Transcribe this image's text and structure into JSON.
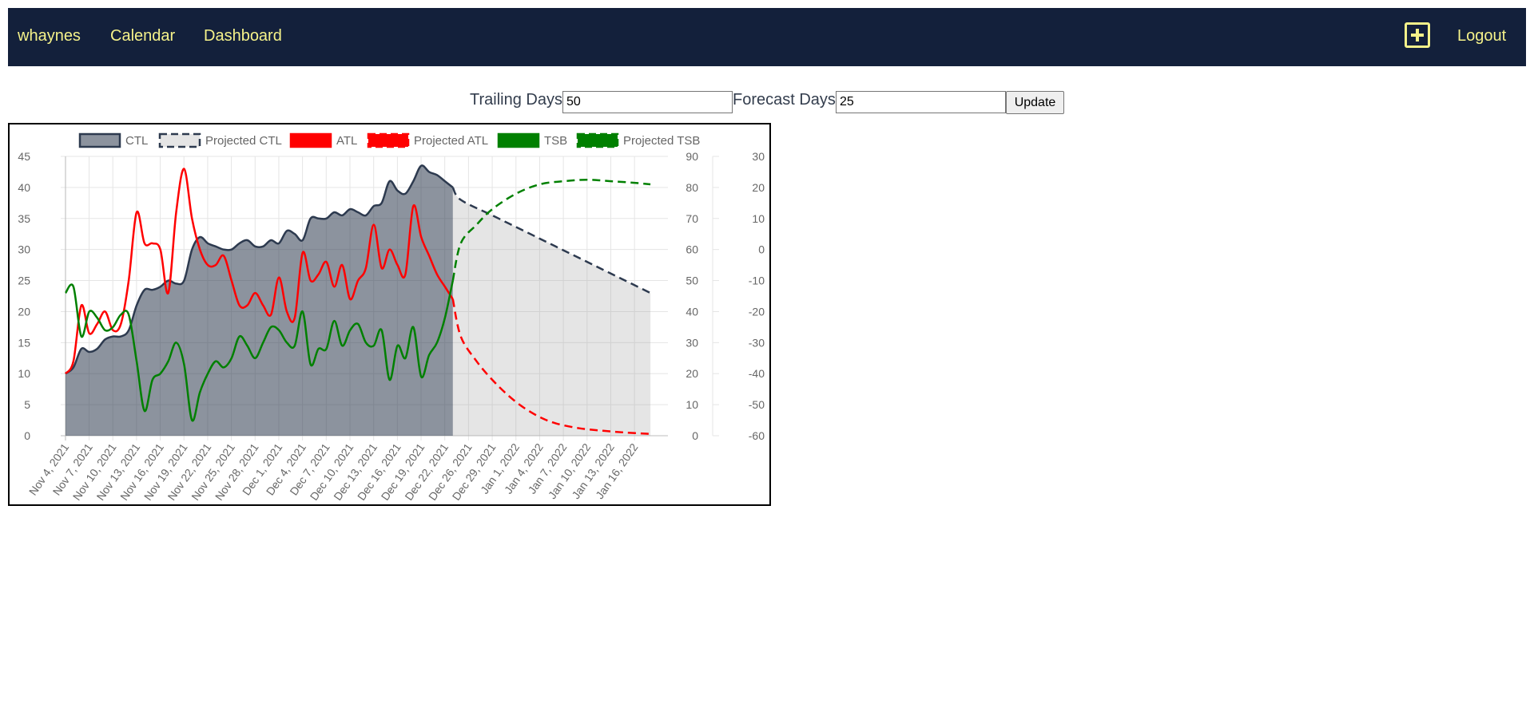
{
  "nav": {
    "user": "whaynes",
    "calendar": "Calendar",
    "dashboard": "Dashboard",
    "add_icon": "plus-square-icon",
    "logout": "Logout"
  },
  "controls": {
    "trailing_label": "Trailing Days",
    "trailing_value": "50",
    "forecast_label": "Forecast Days",
    "forecast_value": "25",
    "update_label": "Update"
  },
  "colors": {
    "nav_bg": "#13203b",
    "nav_text": "#f5f28a",
    "ctl": "#2d3a4f",
    "atl": "#ff0000",
    "tsb": "#008000"
  },
  "chart_data": {
    "type": "line",
    "x_tick_labels": [
      "Nov 4, 2021",
      "Nov 7, 2021",
      "Nov 10, 2021",
      "Nov 13, 2021",
      "Nov 16, 2021",
      "Nov 19, 2021",
      "Nov 22, 2021",
      "Nov 25, 2021",
      "Nov 28, 2021",
      "Dec 1, 2021",
      "Dec 4, 2021",
      "Dec 7, 2021",
      "Dec 10, 2021",
      "Dec 13, 2021",
      "Dec 16, 2021",
      "Dec 19, 2021",
      "Dec 22, 2021",
      "Dec 26, 2021",
      "Dec 29, 2021",
      "Jan 1, 2022",
      "Jan 4, 2022",
      "Jan 7, 2022",
      "Jan 10, 2022",
      "Jan 13, 2022",
      "Jan 16, 2022"
    ],
    "x_range": [
      "2021-11-04",
      "2022-01-18"
    ],
    "y_axes": {
      "left": {
        "min": 0,
        "max": 45,
        "ticks": [
          "45",
          "40",
          "35",
          "30",
          "25",
          "20",
          "15",
          "10",
          "5",
          "0"
        ]
      },
      "right1": {
        "min": 0,
        "max": 90,
        "ticks": [
          "90",
          "80",
          "70",
          "60",
          "50",
          "40",
          "30",
          "20",
          "10",
          "0"
        ]
      },
      "right2": {
        "min": -60,
        "max": 30,
        "ticks": [
          "30",
          "20",
          "10",
          "0",
          "-10",
          "-20",
          "-30",
          "-40",
          "-50",
          "-60"
        ]
      }
    },
    "legend": {
      "position": "top",
      "items": [
        "CTL",
        "Projected CTL",
        "ATL",
        "Projected ATL",
        "TSB",
        "Projected TSB"
      ]
    },
    "grid": true,
    "series": [
      {
        "name": "CTL",
        "axis": "left",
        "fill": true,
        "dashed": false,
        "x": [
          "2021-11-04",
          "2021-11-05",
          "2021-11-06",
          "2021-11-07",
          "2021-11-08",
          "2021-11-09",
          "2021-11-10",
          "2021-11-11",
          "2021-11-12",
          "2021-11-13",
          "2021-11-14",
          "2021-11-15",
          "2021-11-16",
          "2021-11-17",
          "2021-11-18",
          "2021-11-19",
          "2021-11-20",
          "2021-11-21",
          "2021-11-22",
          "2021-11-23",
          "2021-11-24",
          "2021-11-25",
          "2021-11-26",
          "2021-11-27",
          "2021-11-28",
          "2021-11-29",
          "2021-11-30",
          "2021-12-01",
          "2021-12-02",
          "2021-12-03",
          "2021-12-04",
          "2021-12-05",
          "2021-12-06",
          "2021-12-07",
          "2021-12-08",
          "2021-12-09",
          "2021-12-10",
          "2021-12-11",
          "2021-12-12",
          "2021-12-13",
          "2021-12-14",
          "2021-12-15",
          "2021-12-16",
          "2021-12-17",
          "2021-12-18",
          "2021-12-19",
          "2021-12-20",
          "2021-12-21",
          "2021-12-22",
          "2021-12-23"
        ],
        "values": [
          10,
          11,
          14,
          13.5,
          14,
          15.5,
          16,
          16,
          17,
          21,
          23.5,
          23.5,
          24,
          25,
          24.5,
          25,
          30,
          32,
          31,
          30.5,
          30,
          30,
          31,
          31.5,
          30.5,
          30.5,
          31.5,
          31,
          33,
          32.5,
          31.5,
          35,
          35,
          35,
          36,
          35.5,
          36.5,
          36,
          35.5,
          37,
          37.5,
          41,
          39.5,
          39,
          41,
          43.5,
          42.5,
          42,
          41,
          40
        ]
      },
      {
        "name": "Projected CTL",
        "axis": "left",
        "fill": true,
        "dashed": true,
        "x": [
          "2021-12-23",
          "2021-12-24",
          "2021-12-28",
          "2022-01-01",
          "2022-01-05",
          "2022-01-09",
          "2022-01-13",
          "2022-01-17"
        ],
        "values": [
          40,
          38,
          35.5,
          33,
          30.5,
          28,
          25.5,
          23
        ]
      },
      {
        "name": "ATL",
        "axis": "left",
        "fill": false,
        "dashed": false,
        "x": [
          "2021-11-04",
          "2021-11-05",
          "2021-11-06",
          "2021-11-07",
          "2021-11-08",
          "2021-11-09",
          "2021-11-10",
          "2021-11-11",
          "2021-11-12",
          "2021-11-13",
          "2021-11-14",
          "2021-11-15",
          "2021-11-16",
          "2021-11-17",
          "2021-11-18",
          "2021-11-19",
          "2021-11-20",
          "2021-11-21",
          "2021-11-22",
          "2021-11-23",
          "2021-11-24",
          "2021-11-25",
          "2021-11-26",
          "2021-11-27",
          "2021-11-28",
          "2021-11-29",
          "2021-11-30",
          "2021-12-01",
          "2021-12-02",
          "2021-12-03",
          "2021-12-04",
          "2021-12-05",
          "2021-12-06",
          "2021-12-07",
          "2021-12-08",
          "2021-12-09",
          "2021-12-10",
          "2021-12-11",
          "2021-12-12",
          "2021-12-13",
          "2021-12-14",
          "2021-12-15",
          "2021-12-16",
          "2021-12-17",
          "2021-12-18",
          "2021-12-19",
          "2021-12-20",
          "2021-12-21",
          "2021-12-22",
          "2021-12-23"
        ],
        "values": [
          10,
          12,
          21,
          16.5,
          18,
          20,
          17,
          18,
          25,
          36,
          31,
          31,
          30,
          23,
          36,
          43,
          35,
          30,
          27.5,
          27.5,
          29,
          25,
          21,
          21,
          23,
          21,
          19.5,
          25.5,
          20,
          19,
          29.5,
          25,
          26,
          28,
          24,
          27.5,
          22,
          25,
          27,
          34,
          27,
          30,
          27.5,
          26,
          37,
          32,
          29,
          26,
          24,
          22
        ]
      },
      {
        "name": "Projected ATL",
        "axis": "left",
        "fill": false,
        "dashed": true,
        "x": [
          "2021-12-23",
          "2021-12-24",
          "2021-12-26",
          "2021-12-28",
          "2021-12-30",
          "2022-01-01",
          "2022-01-03",
          "2022-01-05",
          "2022-01-08",
          "2022-01-11",
          "2022-01-14",
          "2022-01-17"
        ],
        "values": [
          22,
          16,
          12,
          9,
          6.5,
          4.5,
          3,
          2,
          1.2,
          0.8,
          0.5,
          0.3
        ]
      },
      {
        "name": "TSB",
        "axis": "right2",
        "fill": false,
        "dashed": false,
        "x": [
          "2021-11-04",
          "2021-11-05",
          "2021-11-06",
          "2021-11-07",
          "2021-11-08",
          "2021-11-09",
          "2021-11-10",
          "2021-11-11",
          "2021-11-12",
          "2021-11-13",
          "2021-11-14",
          "2021-11-15",
          "2021-11-16",
          "2021-11-17",
          "2021-11-18",
          "2021-11-19",
          "2021-11-20",
          "2021-11-21",
          "2021-11-22",
          "2021-11-23",
          "2021-11-24",
          "2021-11-25",
          "2021-11-26",
          "2021-11-27",
          "2021-11-28",
          "2021-11-29",
          "2021-11-30",
          "2021-12-01",
          "2021-12-02",
          "2021-12-03",
          "2021-12-04",
          "2021-12-05",
          "2021-12-06",
          "2021-12-07",
          "2021-12-08",
          "2021-12-09",
          "2021-12-10",
          "2021-12-11",
          "2021-12-12",
          "2021-12-13",
          "2021-12-14",
          "2021-12-15",
          "2021-12-16",
          "2021-12-17",
          "2021-12-18",
          "2021-12-19",
          "2021-12-20",
          "2021-12-21",
          "2021-12-22",
          "2021-12-23"
        ],
        "values": [
          -14,
          -12,
          -28,
          -20,
          -22,
          -26,
          -25,
          -21,
          -21,
          -36,
          -52,
          -42,
          -40,
          -36,
          -30,
          -37,
          -55,
          -46,
          -40,
          -36,
          -38,
          -35,
          -28,
          -31,
          -35,
          -30,
          -25,
          -26,
          -30,
          -31,
          -20,
          -37,
          -32,
          -32,
          -23,
          -31,
          -26,
          -24,
          -30,
          -31,
          -26,
          -42,
          -31,
          -35,
          -25,
          -41,
          -34,
          -30,
          -22,
          -10
        ]
      },
      {
        "name": "Projected TSB",
        "axis": "right2",
        "fill": false,
        "dashed": true,
        "x": [
          "2021-12-23",
          "2021-12-24",
          "2021-12-26",
          "2021-12-28",
          "2021-12-31",
          "2022-01-03",
          "2022-01-06",
          "2022-01-09",
          "2022-01-12",
          "2022-01-15",
          "2022-01-17"
        ],
        "values": [
          -10,
          2,
          8,
          13,
          18,
          21,
          22,
          22.5,
          22,
          21.5,
          21
        ]
      }
    ]
  }
}
